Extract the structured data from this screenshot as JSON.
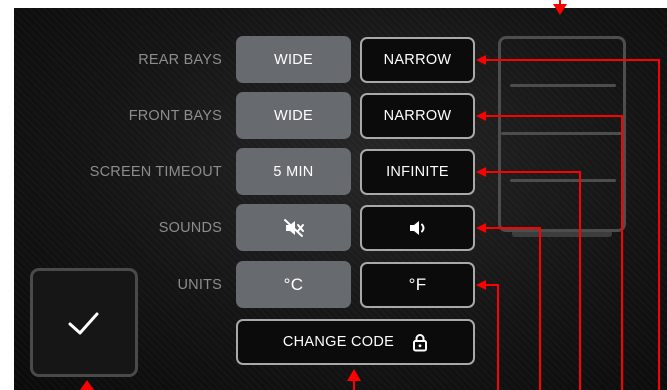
{
  "settings": {
    "rear_bays": {
      "label": "REAR BAYS",
      "options": [
        "WIDE",
        "NARROW"
      ],
      "selected": "WIDE"
    },
    "front_bays": {
      "label": "FRONT BAYS",
      "options": [
        "WIDE",
        "NARROW"
      ],
      "selected": "WIDE"
    },
    "screen_timeout": {
      "label": "SCREEN TIMEOUT",
      "options": [
        "5 MIN",
        "INFINITE"
      ],
      "selected": "5 MIN"
    },
    "sounds": {
      "label": "SOUNDS",
      "options": [
        "sound-muted-icon",
        "sound-on-icon"
      ],
      "selected": "sound-muted-icon"
    },
    "units": {
      "label": "UNITS",
      "options": [
        "°C",
        "°F"
      ],
      "selected": "°C"
    }
  },
  "change_code": {
    "label": "CHANGE CODE",
    "icon": "lock-icon"
  },
  "confirm": {
    "icon": "checkmark-icon"
  },
  "graphic": {
    "name": "bay-layout-graphic"
  },
  "colors": {
    "background": "#151515",
    "selected_button": "#676b6f",
    "unselected_border": "#a9a9a9",
    "label_text": "#8d8d8d",
    "annotation_red": "#ff0000"
  }
}
